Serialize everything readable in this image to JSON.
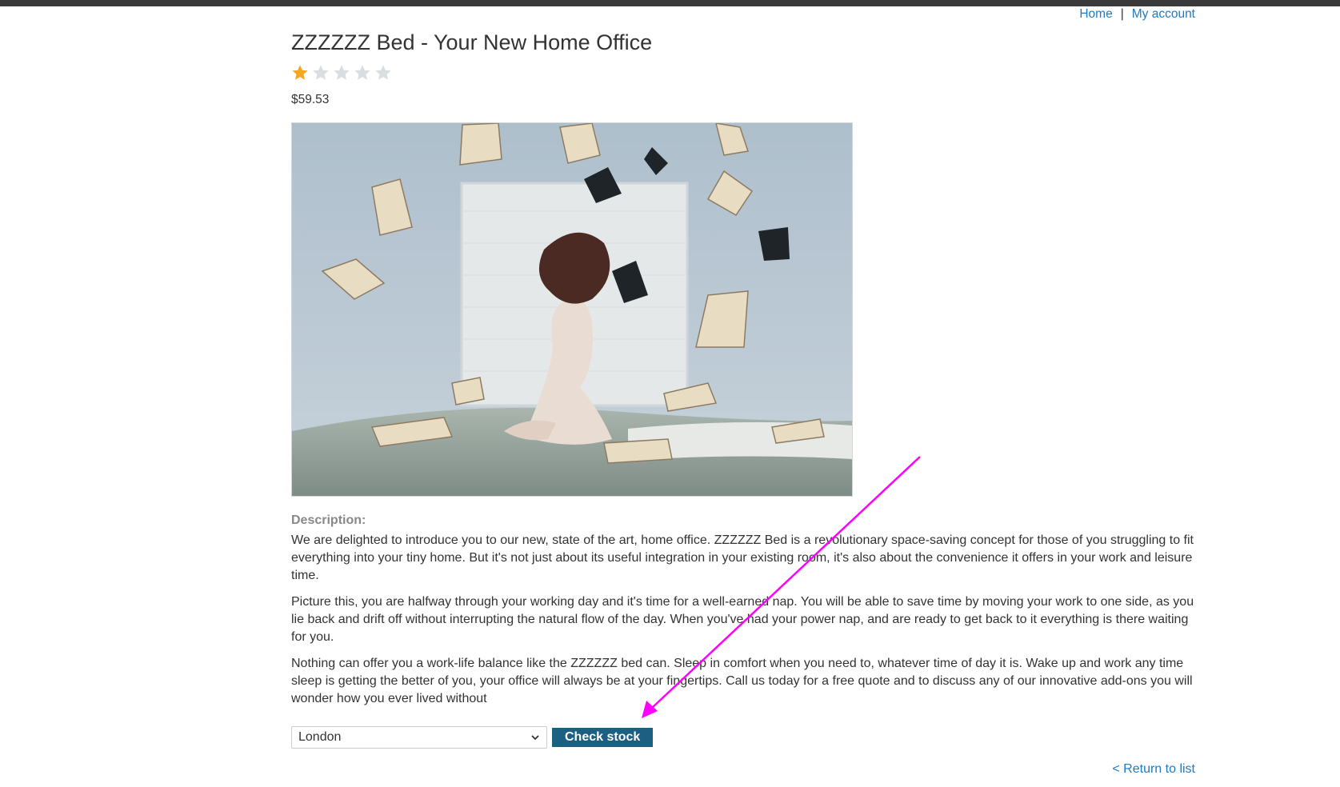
{
  "nav": {
    "home": "Home",
    "separator": "|",
    "account": "My account"
  },
  "product": {
    "title": "ZZZZZZ Bed - Your New Home Office",
    "rating": {
      "value": 1,
      "max": 5,
      "filled_color": "#f5a623",
      "empty_color": "#d9dee2"
    },
    "price": "$59.53",
    "description_label": "Description:",
    "description": [
      "We are delighted to introduce you to our new, state of the art, home office. ZZZZZZ Bed is a revolutionary space-saving concept for those of you struggling to fit everything into your tiny home. But it's not just about its useful integration in your existing room, it's also about the convenience it offers in your work and leisure time.",
      "Picture this, you are halfway through your working day and it's time for a well-earned nap. You will be able to save time by moving your work to one side, as you lie back and drift off without interrupting the natural flow of the day. When you've had your power nap, and are ready to get back to it everything is there waiting for you.",
      "Nothing can offer you a work-life balance like the ZZZZZZ bed can. Sleep in comfort when you need to, whatever time of day it is. Wake up and work any time sleep is getting the better of you, your office will always be at your fingertips. Call us today for a free quote and to discuss any of our innovative add-ons you will wonder how you ever lived without"
    ]
  },
  "stock": {
    "selected_store": "London",
    "button_label": "Check stock"
  },
  "return_link": "< Return to list",
  "colors": {
    "link": "#1f7ac2",
    "button": "#1c5f82",
    "annotation_arrow": "#ff00ff"
  }
}
